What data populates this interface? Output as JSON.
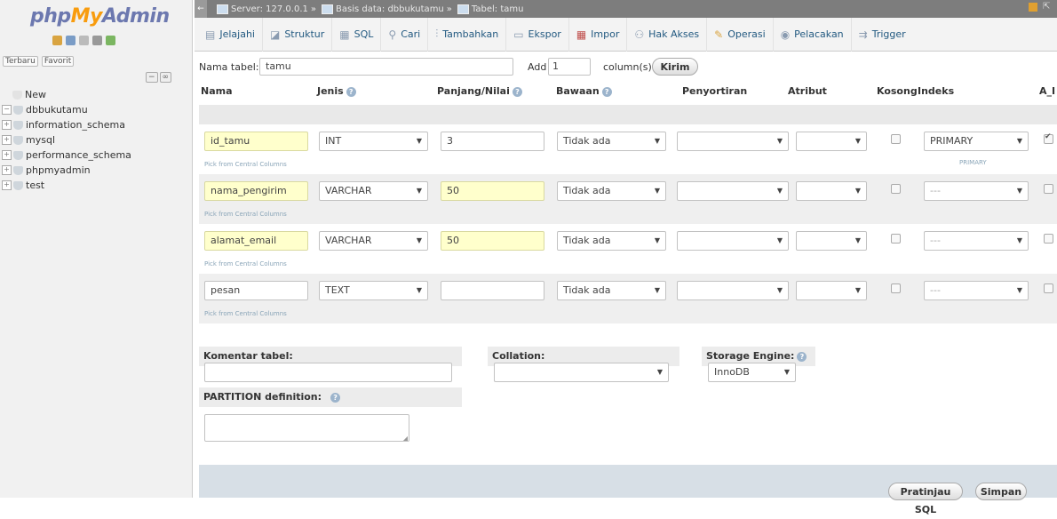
{
  "nav": {
    "logo": {
      "php": "php",
      "my": "My",
      "admin": "Admin"
    },
    "tabs": [
      "Terbaru",
      "Favorit"
    ],
    "tree": [
      "New",
      "dbbukutamu",
      "information_schema",
      "mysql",
      "performance_schema",
      "phpmyadmin",
      "test"
    ]
  },
  "breadcrumb": {
    "server": "Server: 127.0.0.1",
    "database": "Basis data: dbbukutamu",
    "table": "Tabel: tamu"
  },
  "tabs": [
    {
      "label": "Jelajahi",
      "icon": "browse-icon"
    },
    {
      "label": "Struktur",
      "icon": "structure-icon"
    },
    {
      "label": "SQL",
      "icon": "sql-icon"
    },
    {
      "label": "Cari",
      "icon": "search-icon"
    },
    {
      "label": "Tambahkan",
      "icon": "insert-icon"
    },
    {
      "label": "Ekspor",
      "icon": "export-icon"
    },
    {
      "label": "Impor",
      "icon": "import-icon"
    },
    {
      "label": "Hak Akses",
      "icon": "privileges-icon"
    },
    {
      "label": "Operasi",
      "icon": "operations-icon"
    },
    {
      "label": "Pelacakan",
      "icon": "tracking-icon"
    },
    {
      "label": "Trigger",
      "icon": "trigger-icon"
    }
  ],
  "form": {
    "table_name_label": "Nama tabel:",
    "table_name": "tamu",
    "add_label": "Add",
    "add_count": "1",
    "columns_label": "column(s)",
    "submit": "Kirim"
  },
  "headers": [
    "Nama",
    "Jenis",
    "Panjang/Nilai",
    "Bawaan",
    "Penyortiran",
    "Atribut",
    "Kosong",
    "Indeks",
    "A_I"
  ],
  "pick_link": "Pick from Central Columns",
  "rows": [
    {
      "name": "id_tamu",
      "type": "INT",
      "length": "3",
      "default": "Tidak ada",
      "index": "PRIMARY",
      "index_note": "PRIMARY",
      "ai": true
    },
    {
      "name": "nama_pengirim",
      "type": "VARCHAR",
      "length": "50",
      "default": "Tidak ada",
      "index": "---",
      "index_note": "",
      "ai": false
    },
    {
      "name": "alamat_email",
      "type": "VARCHAR",
      "length": "50",
      "default": "Tidak ada",
      "index": "---",
      "index_note": "",
      "ai": false
    },
    {
      "name": "pesan",
      "type": "TEXT",
      "length": "",
      "default": "Tidak ada",
      "index": "---",
      "index_note": "",
      "ai": false
    }
  ],
  "options": {
    "comment_label": "Komentar tabel:",
    "collation_label": "Collation:",
    "engine_label": "Storage Engine:",
    "engine_value": "InnoDB",
    "partition_label": "PARTITION definition:"
  },
  "footer": {
    "preview": "Pratinjau SQL",
    "save": "Simpan"
  }
}
